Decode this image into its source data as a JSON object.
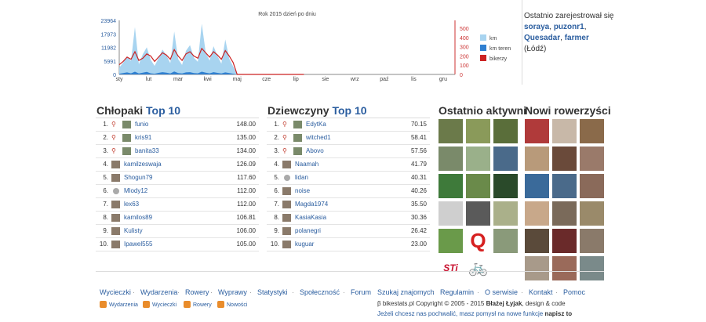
{
  "colors": {
    "accent": "#2a5d9f",
    "km": "#a8d4f0",
    "km_teren": "#2f7fd0",
    "bikerzy": "#cc2222"
  },
  "chart_data": {
    "type": "area",
    "title": "Rok 2015 dzień po dniu",
    "x_tick_labels": [
      "sty",
      "lut",
      "mar",
      "kwi",
      "maj",
      "cze",
      "lip",
      "sie",
      "wrz",
      "paź",
      "lis",
      "gru"
    ],
    "y_left_ticks": [
      "23964",
      "17973",
      "11982",
      "5991",
      "0"
    ],
    "y_right_ticks": [
      "500",
      "400",
      "300",
      "200",
      "100",
      "0"
    ],
    "ylim_left": [
      0,
      23964
    ],
    "ylim_right": [
      0,
      500
    ],
    "series": [
      {
        "name": "km",
        "axis": "left",
        "values": [
          3000,
          5200,
          8000,
          6000,
          21000,
          4500,
          9000,
          12000,
          6500,
          3800,
          7200,
          11000,
          8500,
          5000,
          19000,
          6800,
          4200,
          10500,
          13000,
          7400,
          5600,
          22500,
          9800,
          6100,
          12500,
          8200,
          4800,
          15500,
          7000,
          3500,
          0,
          0,
          0,
          0,
          0,
          0,
          0,
          0,
          0,
          0,
          0,
          0,
          0,
          0,
          0,
          0,
          0,
          0
        ]
      },
      {
        "name": "km teren",
        "axis": "left",
        "values": [
          300,
          600,
          900,
          500,
          1200,
          400,
          800,
          1100,
          500,
          300,
          700,
          1000,
          800,
          400,
          1300,
          600,
          400,
          900,
          1000,
          600,
          500,
          1200,
          800,
          500,
          1000,
          700,
          400,
          900,
          600,
          300,
          0,
          0,
          0,
          0,
          0,
          0,
          0,
          0,
          0,
          0,
          0,
          0,
          0,
          0,
          0,
          0,
          0,
          0,
          0
        ]
      },
      {
        "name": "bikerzy",
        "axis": "right",
        "values": [
          90,
          120,
          160,
          140,
          210,
          130,
          150,
          190,
          170,
          120,
          160,
          200,
          180,
          140,
          230,
          170,
          130,
          190,
          210,
          170,
          150,
          240,
          200,
          160,
          210,
          180,
          140,
          220,
          170,
          110,
          0,
          0,
          0,
          0,
          0,
          0,
          0,
          0,
          0,
          0,
          0,
          0,
          0,
          0,
          0,
          0,
          0,
          0
        ]
      }
    ]
  },
  "registered": {
    "prefix": "Ostatnio zarejestrował się",
    "users": [
      "soraya",
      "puzonr1",
      "Quesadar",
      "farmer"
    ],
    "location": "(Łódź)"
  },
  "boys": {
    "title": "Chłopaki",
    "highlight": "Top 10",
    "rows": [
      {
        "rank": "1.",
        "name": "funio",
        "value": "148.00",
        "icon": "bike"
      },
      {
        "rank": "2.",
        "name": "kris91",
        "value": "135.00",
        "icon": "bike"
      },
      {
        "rank": "3.",
        "name": "banita33",
        "value": "134.00",
        "icon": "bike"
      },
      {
        "rank": "4.",
        "name": "kamilzeswaja",
        "value": "126.09",
        "icon": ""
      },
      {
        "rank": "5.",
        "name": "Shogun79",
        "value": "117.60",
        "icon": ""
      },
      {
        "rank": "6.",
        "name": "Mlody12",
        "value": "112.00",
        "icon": "spin"
      },
      {
        "rank": "7.",
        "name": "lex63",
        "value": "112.00",
        "icon": ""
      },
      {
        "rank": "8.",
        "name": "kamilos89",
        "value": "106.81",
        "icon": ""
      },
      {
        "rank": "9.",
        "name": "Kulisty",
        "value": "106.00",
        "icon": ""
      },
      {
        "rank": "10.",
        "name": "Ipawel555",
        "value": "105.00",
        "icon": ""
      }
    ]
  },
  "girls": {
    "title": "Dziewczyny",
    "highlight": "Top 10",
    "rows": [
      {
        "rank": "1.",
        "name": "EdytKa",
        "value": "70.15",
        "icon": "bike"
      },
      {
        "rank": "2.",
        "name": "witched1",
        "value": "58.41",
        "icon": "bike"
      },
      {
        "rank": "3.",
        "name": "Abovo",
        "value": "57.56",
        "icon": "bike"
      },
      {
        "rank": "4.",
        "name": "Naamah",
        "value": "41.79",
        "icon": ""
      },
      {
        "rank": "5.",
        "name": "lidan",
        "value": "40.31",
        "icon": "spin"
      },
      {
        "rank": "6.",
        "name": "noise",
        "value": "40.26",
        "icon": ""
      },
      {
        "rank": "7.",
        "name": "Magda1974",
        "value": "35.50",
        "icon": ""
      },
      {
        "rank": "8.",
        "name": "KasiaKasia",
        "value": "30.36",
        "icon": ""
      },
      {
        "rank": "9.",
        "name": "polanegri",
        "value": "26.42",
        "icon": ""
      },
      {
        "rank": "10.",
        "name": "kuguar",
        "value": "23.00",
        "icon": ""
      }
    ]
  },
  "active": {
    "title": "Ostatnio aktywni",
    "tiles": [
      "#6b7a4a",
      "#8a9a5a",
      "#5a6e3a",
      "#7a8a6a",
      "#9ab08a",
      "#4a6a8a",
      "#3e7a3a",
      "#6a8a4a",
      "#2a4a2a",
      "#cfcfcf",
      "#5a5a5a",
      "#aab08a",
      "#6a9a4a",
      "#q",
      "#8a9a7a",
      "#sti",
      "#bike",
      "#ffffff"
    ]
  },
  "newusers": {
    "title": "Nowi rowerzyści",
    "tiles": [
      "#b03a3a",
      "#c8b8a8",
      "#8a6a4a",
      "#b89a7a",
      "#6a4a3a",
      "#9a7a6a",
      "#3a6a9a",
      "#4a6a8a",
      "#8a6a5a",
      "#c8a88a",
      "#7a6a5a",
      "#9a8a6a",
      "#5a4a3a",
      "#6a2a2a",
      "#8a7a6a",
      "#a89a8a",
      "#9a6a5a",
      "#7a8a8a"
    ]
  },
  "footer": {
    "left_links": [
      "Wycieczki",
      "Wydarzenia",
      "Rowery",
      "Wyprawy",
      "Statystyki",
      "Społeczność",
      "Forum"
    ],
    "right_links": [
      "Szukaj znajomych",
      "Regulamin",
      "O serwisie",
      "Kontakt",
      "Pomoc"
    ],
    "rss": [
      "Wydarzenia",
      "Wycieczki",
      "Rowery",
      "Nowości"
    ],
    "copyright_prefix": "β bikestats.pl Copyright © 2005 - 2015",
    "author": "Błażej Łyjak",
    "copyright_suffix": ", design & code",
    "praise": "Jeżeli chcesz nas pochwalić, masz pomysł na nowe funkcje",
    "praise_bold": "napisz to"
  }
}
